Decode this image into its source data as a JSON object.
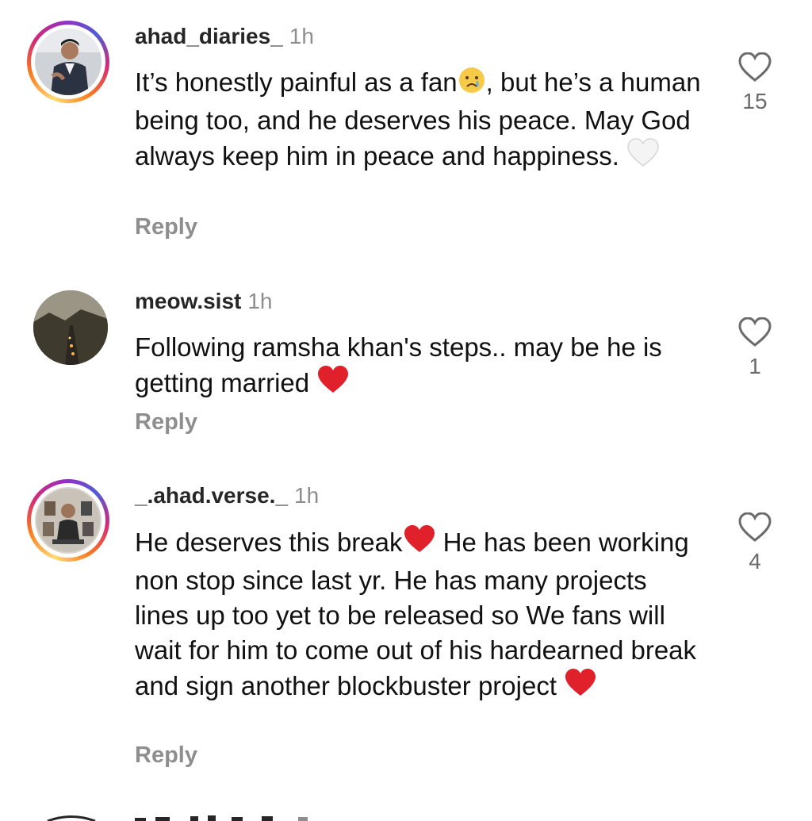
{
  "comments": [
    {
      "username": "ahad_diaries_",
      "time": "1h",
      "text_a": "It’s honestly painful as a fan",
      "text_b": ", but he’s a human being too, and he deserves his peace. May God always keep him in peace and happiness. ",
      "emoji_a": "crying-face",
      "emoji_b": "white-heart",
      "reply": "Reply",
      "likes": "15"
    },
    {
      "username": "meow.sist",
      "time": "1h",
      "text_a": "Following ramsha khan's steps.. may be he is getting married ",
      "emoji_a": "red-heart",
      "reply": "Reply",
      "likes": "1"
    },
    {
      "username": "_.ahad.verse._",
      "time": "1h",
      "text_a": "He deserves this break",
      "text_b": " He has been working non stop since last yr. He has many projects lines up too yet to be released so We fans will wait for him to come out of his hardearned break and sign another blockbuster project ",
      "emoji_a": "red-heart",
      "emoji_b": "red-heart",
      "reply": "Reply",
      "likes": "4"
    }
  ],
  "colors": {
    "username": "#262626",
    "muted": "#8e8e8e",
    "heart": "#e0202a"
  }
}
